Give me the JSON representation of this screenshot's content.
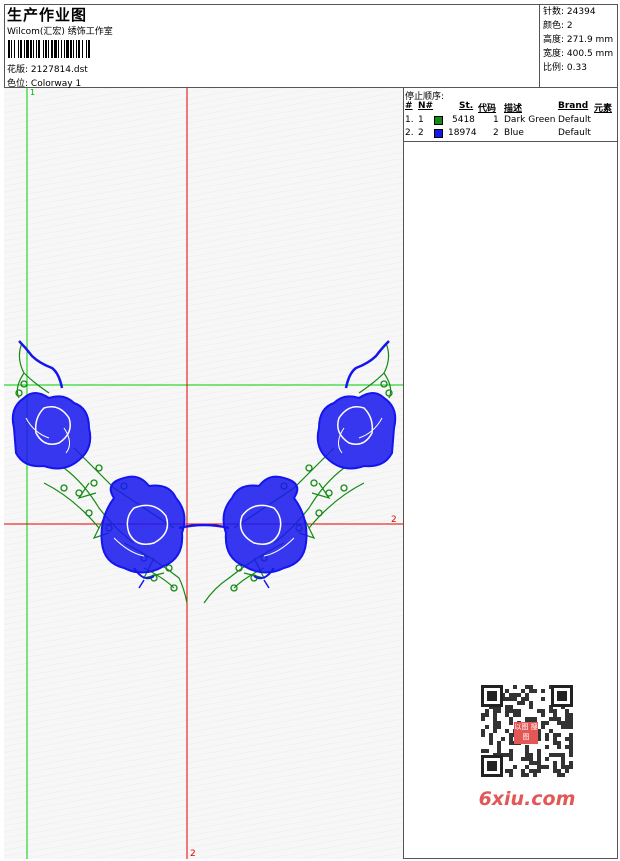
{
  "header": {
    "title": "生产作业图",
    "company": "Wilcom(汇宏) 绣饰工作室",
    "pattern_label": "花版:",
    "pattern_value": "2127814.dst",
    "colorway_label": "色位:",
    "colorway_value": "Colorway 1"
  },
  "specs": {
    "stitches_label": "针数:",
    "stitches_value": "24394",
    "colors_label": "颜色:",
    "colors_value": "2",
    "height_label": "高度:",
    "height_value": "271.9 mm",
    "width_label": "宽度:",
    "width_value": "400.5 mm",
    "scale_label": "比例:",
    "scale_value": "0.33"
  },
  "stop_sequence": {
    "caption": "停止顺序:",
    "columns": [
      "#",
      "N#",
      "St.",
      "代码",
      "描述",
      "Brand",
      "元素"
    ],
    "rows": [
      {
        "idx": "1.",
        "n": "1",
        "color": "#138a13",
        "st": "5418",
        "code": "1",
        "desc": "Dark Green",
        "brand": "Default"
      },
      {
        "idx": "2.",
        "n": "2",
        "color": "#1515ee",
        "st": "18974",
        "code": "2",
        "desc": "Blue",
        "brand": "Default"
      }
    ]
  },
  "guides": {
    "v_green_label": "1",
    "h_red_label": "2",
    "v_red_label": "2"
  },
  "watermark": {
    "text": "6xiu.com",
    "stamp": "以图\n搜图"
  },
  "colors": {
    "thread_green": "#138a13",
    "thread_blue": "#1515ee",
    "guide_red": "#e00000",
    "guide_green": "#00cc00"
  }
}
